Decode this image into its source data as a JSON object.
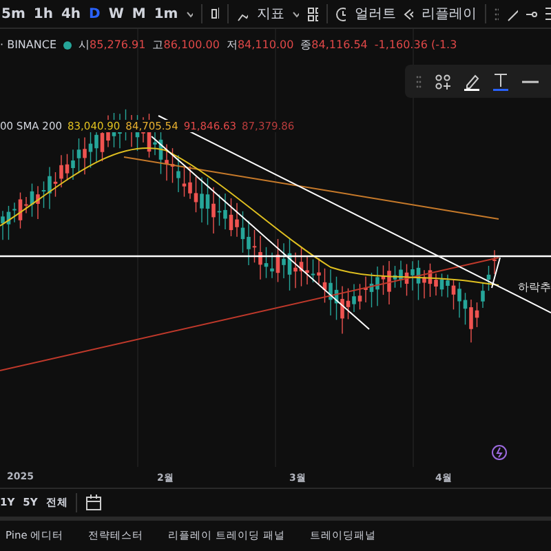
{
  "toolbar": {
    "intervals": [
      {
        "label": "5m",
        "selected": false
      },
      {
        "label": "1h",
        "selected": false
      },
      {
        "label": "4h",
        "selected": false
      },
      {
        "label": "D",
        "selected": true
      },
      {
        "label": "W",
        "selected": false
      },
      {
        "label": "M",
        "selected": false
      },
      {
        "label": "1m",
        "selected": false
      }
    ],
    "indicators_label": "지표",
    "alert_label": "얼러트",
    "replay_label": "리플레이"
  },
  "legend": {
    "symbol": "· BINANCE",
    "values": [
      {
        "prefix": "시",
        "value": "85,276.91"
      },
      {
        "prefix": "고",
        "value": "86,100.00"
      },
      {
        "prefix": "저",
        "value": "84,110.00"
      },
      {
        "prefix": "종",
        "value": "84,116.54"
      }
    ],
    "change": "-1,160.36 (-1.3"
  },
  "sma": {
    "label": "00 SMA 200",
    "values": [
      {
        "value": "83,040.90",
        "color": "#e0c020"
      },
      {
        "value": "84,705.54",
        "color": "#e8b030"
      },
      {
        "value": "91,846.63",
        "color": "#e04848"
      },
      {
        "value": "87,379.86",
        "color": "#b83c3c"
      }
    ]
  },
  "chart_label": "하락추",
  "time_axis": [
    "2025",
    "2월",
    "3월",
    "4월"
  ],
  "ranges": [
    "1Y",
    "5Y",
    "전체"
  ],
  "bottom_tabs": [
    "Pine 에디터",
    "전략테스터",
    "리플레이 트레이딩 패널",
    "트레이딩패널"
  ]
}
